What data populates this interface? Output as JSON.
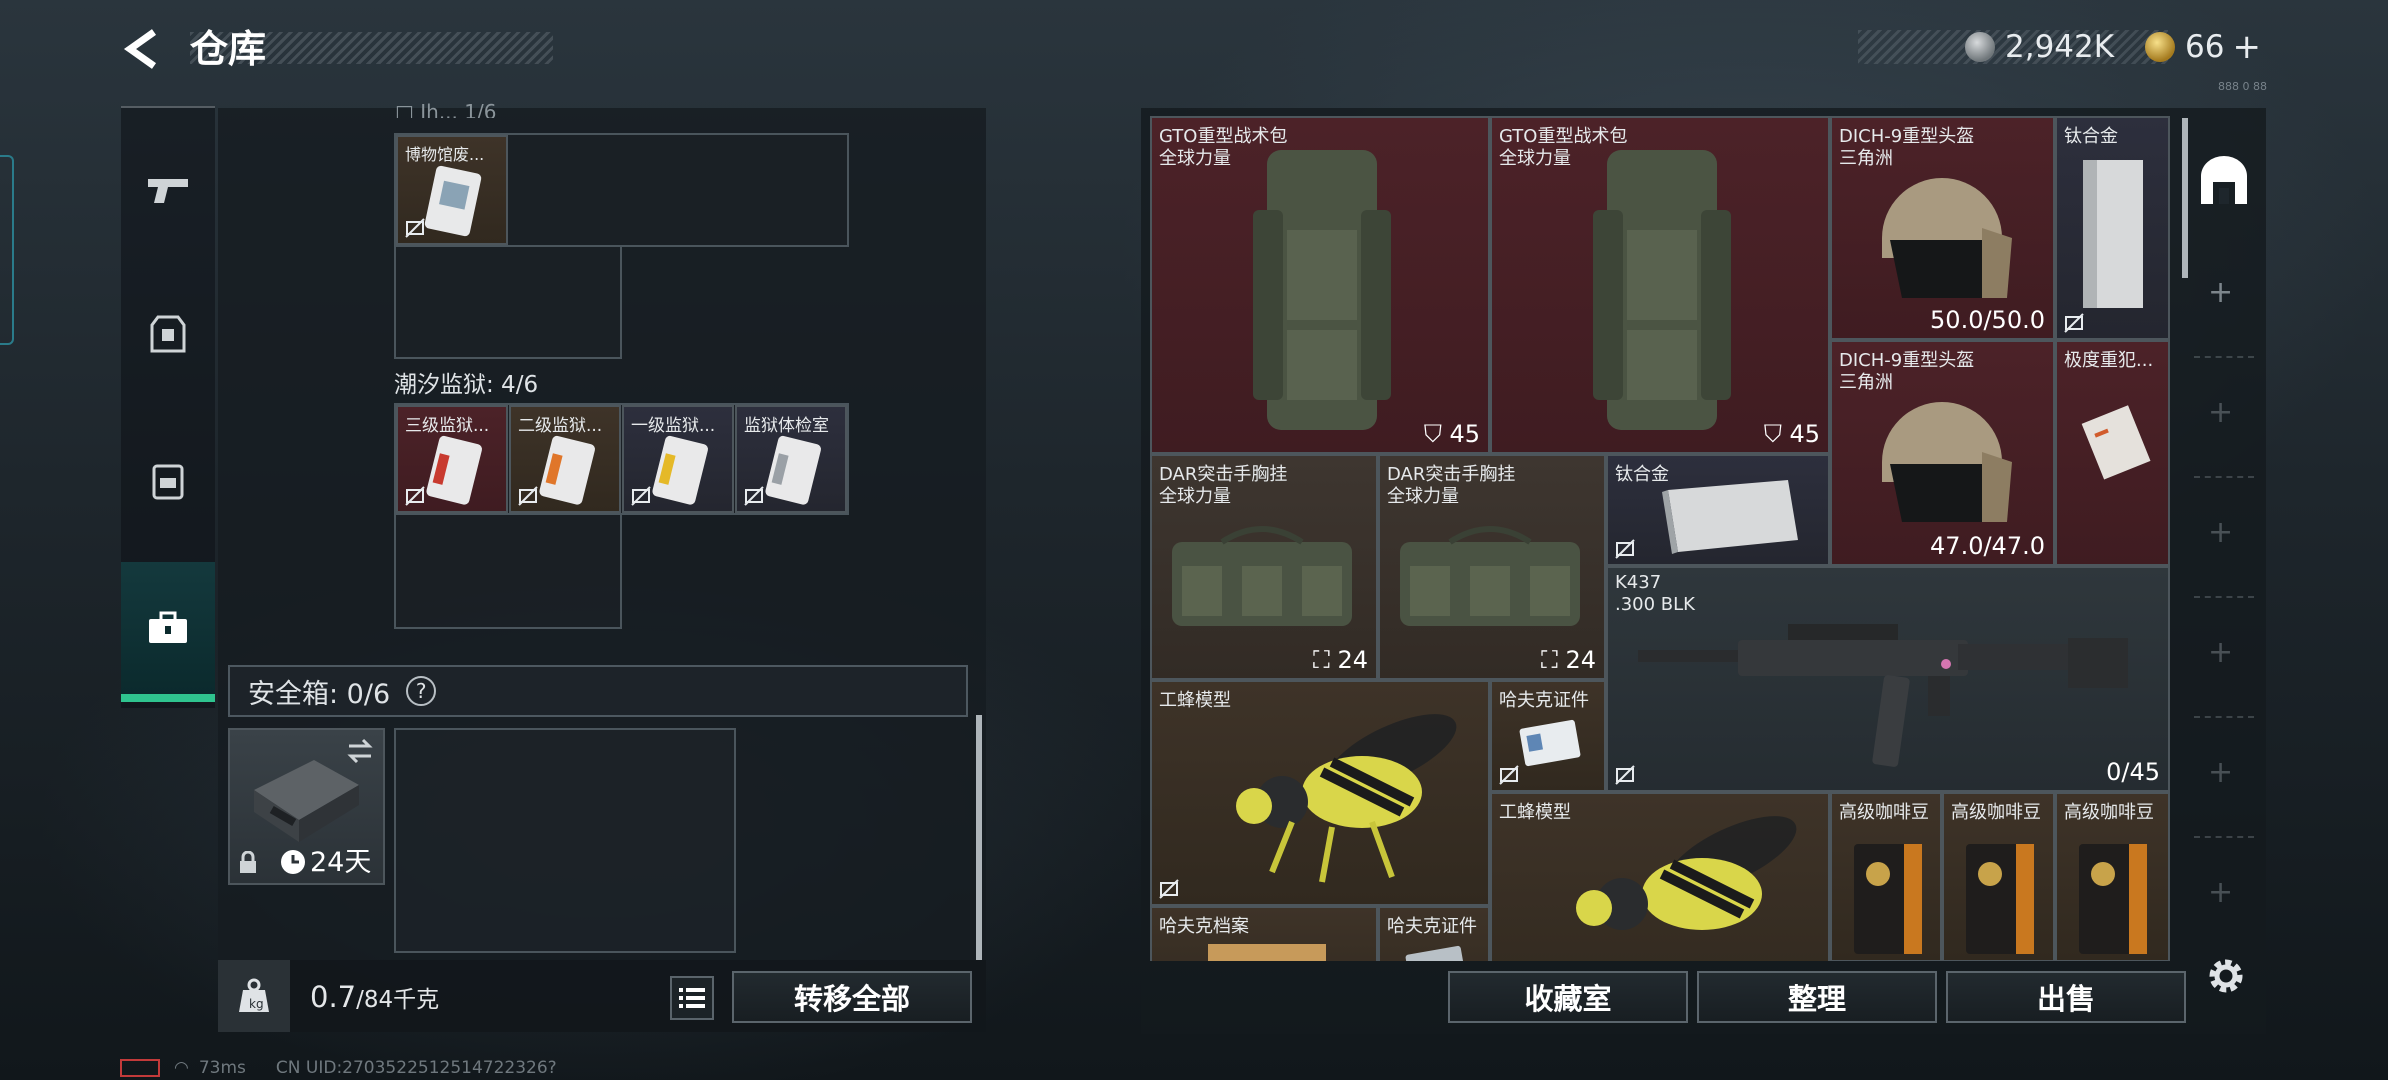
{
  "header": {
    "title": "仓库"
  },
  "currency": {
    "coin": "2,942K",
    "gold": "66",
    "plus": "+",
    "hint": "888 0 88"
  },
  "left_storage": {
    "cut_label": "□ Jh... 1/6",
    "museum_item": "博物馆废...",
    "section_title": "潮汐监狱: 4/6",
    "prison_items": [
      "三级监狱...",
      "二级监狱...",
      "一级监狱...",
      "监狱体检室"
    ]
  },
  "safebox": {
    "label": "安全箱: 0/6",
    "help": "?",
    "timer": "24天"
  },
  "bottom_left": {
    "weight": "0.7",
    "weight_cap": "/84千克",
    "transfer_all": "转移全部"
  },
  "inventory": {
    "backpack1": {
      "name": "GTO重型战术包",
      "sub": "全球力量",
      "stat": "45"
    },
    "backpack2": {
      "name": "GTO重型战术包",
      "sub": "全球力量",
      "stat": "45"
    },
    "helmet1": {
      "name": "DICH-9重型头盔",
      "sub": "三角洲",
      "stat": "50.0/50.0"
    },
    "titanium1": {
      "name": "钛合金"
    },
    "helmet2": {
      "name": "DICH-9重型头盔",
      "sub": "三角洲",
      "stat": "47.0/47.0"
    },
    "criminal": {
      "name": "极度重犯..."
    },
    "rig1": {
      "name": "DAR突击手胸挂",
      "sub": "全球力量",
      "stat": "24"
    },
    "rig2": {
      "name": "DAR突击手胸挂",
      "sub": "全球力量",
      "stat": "24"
    },
    "titanium2": {
      "name": "钛合金"
    },
    "rifle": {
      "name": "K437",
      "sub": ".300 BLK",
      "stat": "0/45"
    },
    "wasp1": {
      "name": "工蜂模型"
    },
    "hafk_id1": {
      "name": "哈夫克证件"
    },
    "wasp2": {
      "name": "工蜂模型"
    },
    "coffee": [
      {
        "name": "高级咖啡豆"
      },
      {
        "name": "高级咖啡豆"
      },
      {
        "name": "高级咖啡豆"
      }
    ],
    "hafk_archive": {
      "name": "哈夫克档案"
    },
    "hafk_id2": {
      "name": "哈夫克证件"
    }
  },
  "bottom_right": {
    "collection": "收藏室",
    "sort": "整理",
    "sell": "出售"
  },
  "status_bar": {
    "ping": "73ms",
    "uid": "CN UID:2703522512514722326?"
  },
  "colors": {
    "accent_green": "#2fc48f",
    "red_rarity": "#4c2228",
    "purple_rarity": "#2d2f3d",
    "gold_rarity": "#3e3328",
    "grey_rarity": "#2f373c"
  }
}
